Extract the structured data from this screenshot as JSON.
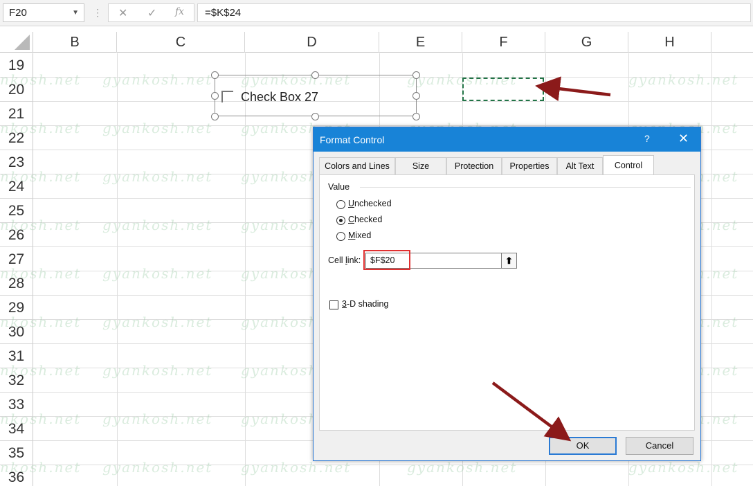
{
  "formula_bar": {
    "name_box": "F20",
    "cancel_icon": "✕",
    "enter_icon": "✓",
    "fx_icon": "fx",
    "formula": "=$K$24"
  },
  "columns": [
    "B",
    "C",
    "D",
    "E",
    "F",
    "G",
    "H"
  ],
  "rows": [
    "19",
    "20",
    "21",
    "22",
    "23",
    "24",
    "25",
    "26",
    "27",
    "28",
    "29",
    "30",
    "31",
    "32",
    "33",
    "34",
    "35",
    "36"
  ],
  "watermark": "gyankosh.net",
  "checkbox_control": {
    "label": "Check Box 27"
  },
  "dialog": {
    "title": "Format Control",
    "help": "?",
    "close": "✕",
    "tabs": [
      "Colors and Lines",
      "Size",
      "Protection",
      "Properties",
      "Alt Text",
      "Control"
    ],
    "active_tab": "Control",
    "value_group_label": "Value",
    "radios": [
      {
        "pre": "",
        "key": "U",
        "post": "nchecked",
        "checked": false
      },
      {
        "pre": "",
        "key": "C",
        "post": "hecked",
        "checked": true
      },
      {
        "pre": "",
        "key": "M",
        "post": "ixed",
        "checked": false
      }
    ],
    "cell_link_label_pre": "Cell ",
    "cell_link_label_key": "l",
    "cell_link_label_post": "ink:",
    "cell_link_value": "$F$20",
    "shading_pre": "",
    "shading_key": "3",
    "shading_post": "-D shading",
    "ok": "OK",
    "cancel": "Cancel"
  },
  "colors": {
    "arrow": "#8b1a1a",
    "dialog_title_bg": "#1883d7",
    "selection": "#217346",
    "highlight": "#e03030"
  }
}
